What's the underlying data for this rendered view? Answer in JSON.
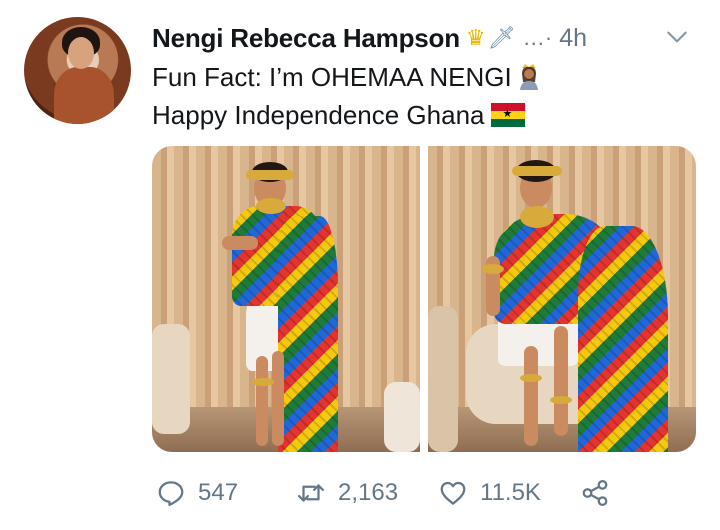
{
  "tweet": {
    "author_name": "Nengi Rebecca Hampson",
    "badges": [
      "crown-emoji",
      "dagger-emoji"
    ],
    "separator": "...·",
    "timestamp": "4h",
    "text_line1": "Fun Fact: I’m OHEMAA NENGI",
    "text_line2": "Happy Independence Ghana"
  },
  "actions": {
    "replies": "547",
    "retweets": "2,163",
    "likes": "11.5K"
  },
  "colors": {
    "text": "#14171a",
    "muted": "#657786"
  }
}
